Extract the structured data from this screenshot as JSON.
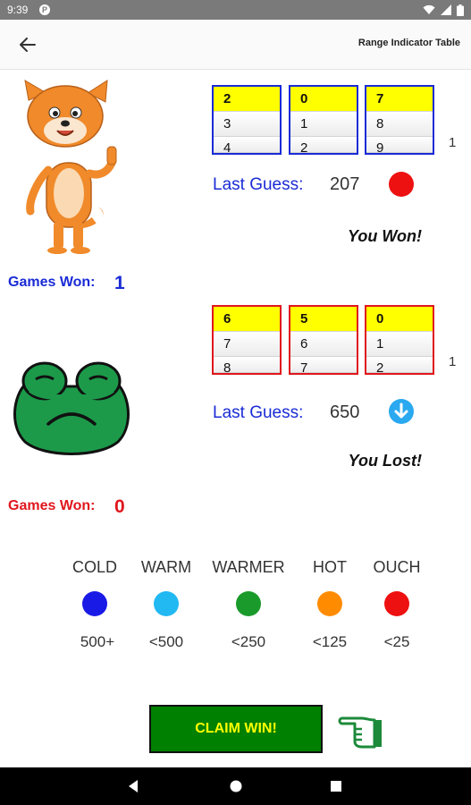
{
  "status_bar": {
    "time": "9:39",
    "app_icon_letter": "P"
  },
  "app_bar": {
    "back_icon": "arrow-left-icon",
    "title": "Range Indicator Table"
  },
  "player1": {
    "wheels": [
      {
        "selected": "2",
        "next": "3",
        "partial": "4"
      },
      {
        "selected": "0",
        "next": "1",
        "partial": "2"
      },
      {
        "selected": "7",
        "next": "8",
        "partial": "9"
      }
    ],
    "side_number": "1",
    "last_guess_label": "Last Guess:",
    "last_guess_value": "207",
    "indicator_color": "#ee1111",
    "result": "You Won!",
    "games_won_label": "Games Won:",
    "games_won_value": "1",
    "accent_color": "#1a2bd6"
  },
  "player2": {
    "wheels": [
      {
        "selected": "6",
        "next": "7",
        "partial": "8"
      },
      {
        "selected": "5",
        "next": "6",
        "partial": "7"
      },
      {
        "selected": "0",
        "next": "1",
        "partial": "2"
      }
    ],
    "side_number": "1",
    "last_guess_label": "Last Guess:",
    "last_guess_value": "650",
    "indicator_icon": "down-arrow-circle-icon",
    "indicator_color": "#2aa9f0",
    "result": "You Lost!",
    "games_won_label": "Games Won:",
    "games_won_value": "0",
    "accent_color": "#e0161d"
  },
  "legend": [
    {
      "label": "COLD",
      "color": "#1a1ae6",
      "range": "500+"
    },
    {
      "label": "WARM",
      "color": "#22b8f2",
      "range": "<500"
    },
    {
      "label": "WARMER",
      "color": "#1a9a2a",
      "range": "<250"
    },
    {
      "label": "HOT",
      "color": "#ff8c00",
      "range": "<125"
    },
    {
      "label": "OUCH",
      "color": "#ee1111",
      "range": "<25"
    }
  ],
  "claim_button": {
    "label": "CLAIM WIN!"
  },
  "pointing_hand_icon": "pointing-hand-icon",
  "nav_bar": {
    "back": "nav-back-icon",
    "home": "nav-home-icon",
    "recents": "nav-recents-icon"
  }
}
